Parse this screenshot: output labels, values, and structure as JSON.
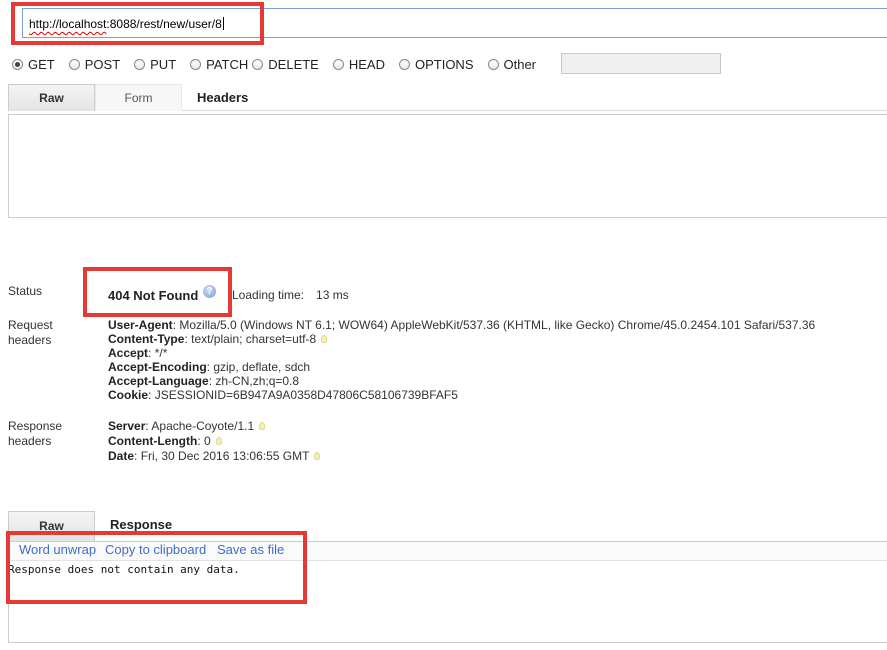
{
  "request": {
    "url_underlined": "http://localhost",
    "url_rest": ":8088/rest/new/user/8",
    "methods": [
      {
        "label": "GET",
        "checked": true
      },
      {
        "label": "POST",
        "checked": false
      },
      {
        "label": "PUT",
        "checked": false
      },
      {
        "label": "PATCH",
        "checked": false
      },
      {
        "label": "DELETE",
        "checked": false
      },
      {
        "label": "HEAD",
        "checked": false
      },
      {
        "label": "OPTIONS",
        "checked": false
      },
      {
        "label": "Other",
        "checked": false
      }
    ],
    "other_value": "",
    "tabs": {
      "raw": "Raw",
      "form": "Form",
      "title": "Headers"
    }
  },
  "status": {
    "label": "Status",
    "code_text": "404 Not Found",
    "help_icon": "question-icon",
    "loading_label": "Loading time:",
    "loading_value": "13 ms"
  },
  "request_headers": {
    "label_line1": "Request",
    "label_line2": "headers",
    "items": [
      {
        "name": "User-Agent",
        "value": "Mozilla/5.0 (Windows NT 6.1; WOW64) AppleWebKit/537.36 (KHTML, like Gecko) Chrome/45.0.2454.101 Safari/537.36"
      },
      {
        "name": "Content-Type",
        "value": "text/plain; charset=utf-8"
      },
      {
        "name": "Accept",
        "value": "*/*"
      },
      {
        "name": "Accept-Encoding",
        "value": "gzip, deflate, sdch"
      },
      {
        "name": "Accept-Language",
        "value": "zh-CN,zh;q=0.8"
      },
      {
        "name": "Cookie",
        "value": "JSESSIONID=6B947A9A0358D47806C58106739BFAF5"
      }
    ]
  },
  "response_headers": {
    "label_line1": "Response",
    "label_line2": "headers",
    "items": [
      {
        "name": "Server",
        "value": "Apache-Coyote/1.1"
      },
      {
        "name": "Content-Length",
        "value": "0"
      },
      {
        "name": "Date",
        "value": "Fri, 30 Dec 2016 13:06:55 GMT"
      }
    ]
  },
  "response": {
    "tabs": {
      "raw": "Raw",
      "title": "Response"
    },
    "links": {
      "word_unwrap": "Word unwrap",
      "copy": "Copy to clipboard",
      "save": "Save as file"
    },
    "body": "Response does not contain any data."
  },
  "colors": {
    "highlight": "#e53935",
    "link": "#3d6fc4"
  }
}
